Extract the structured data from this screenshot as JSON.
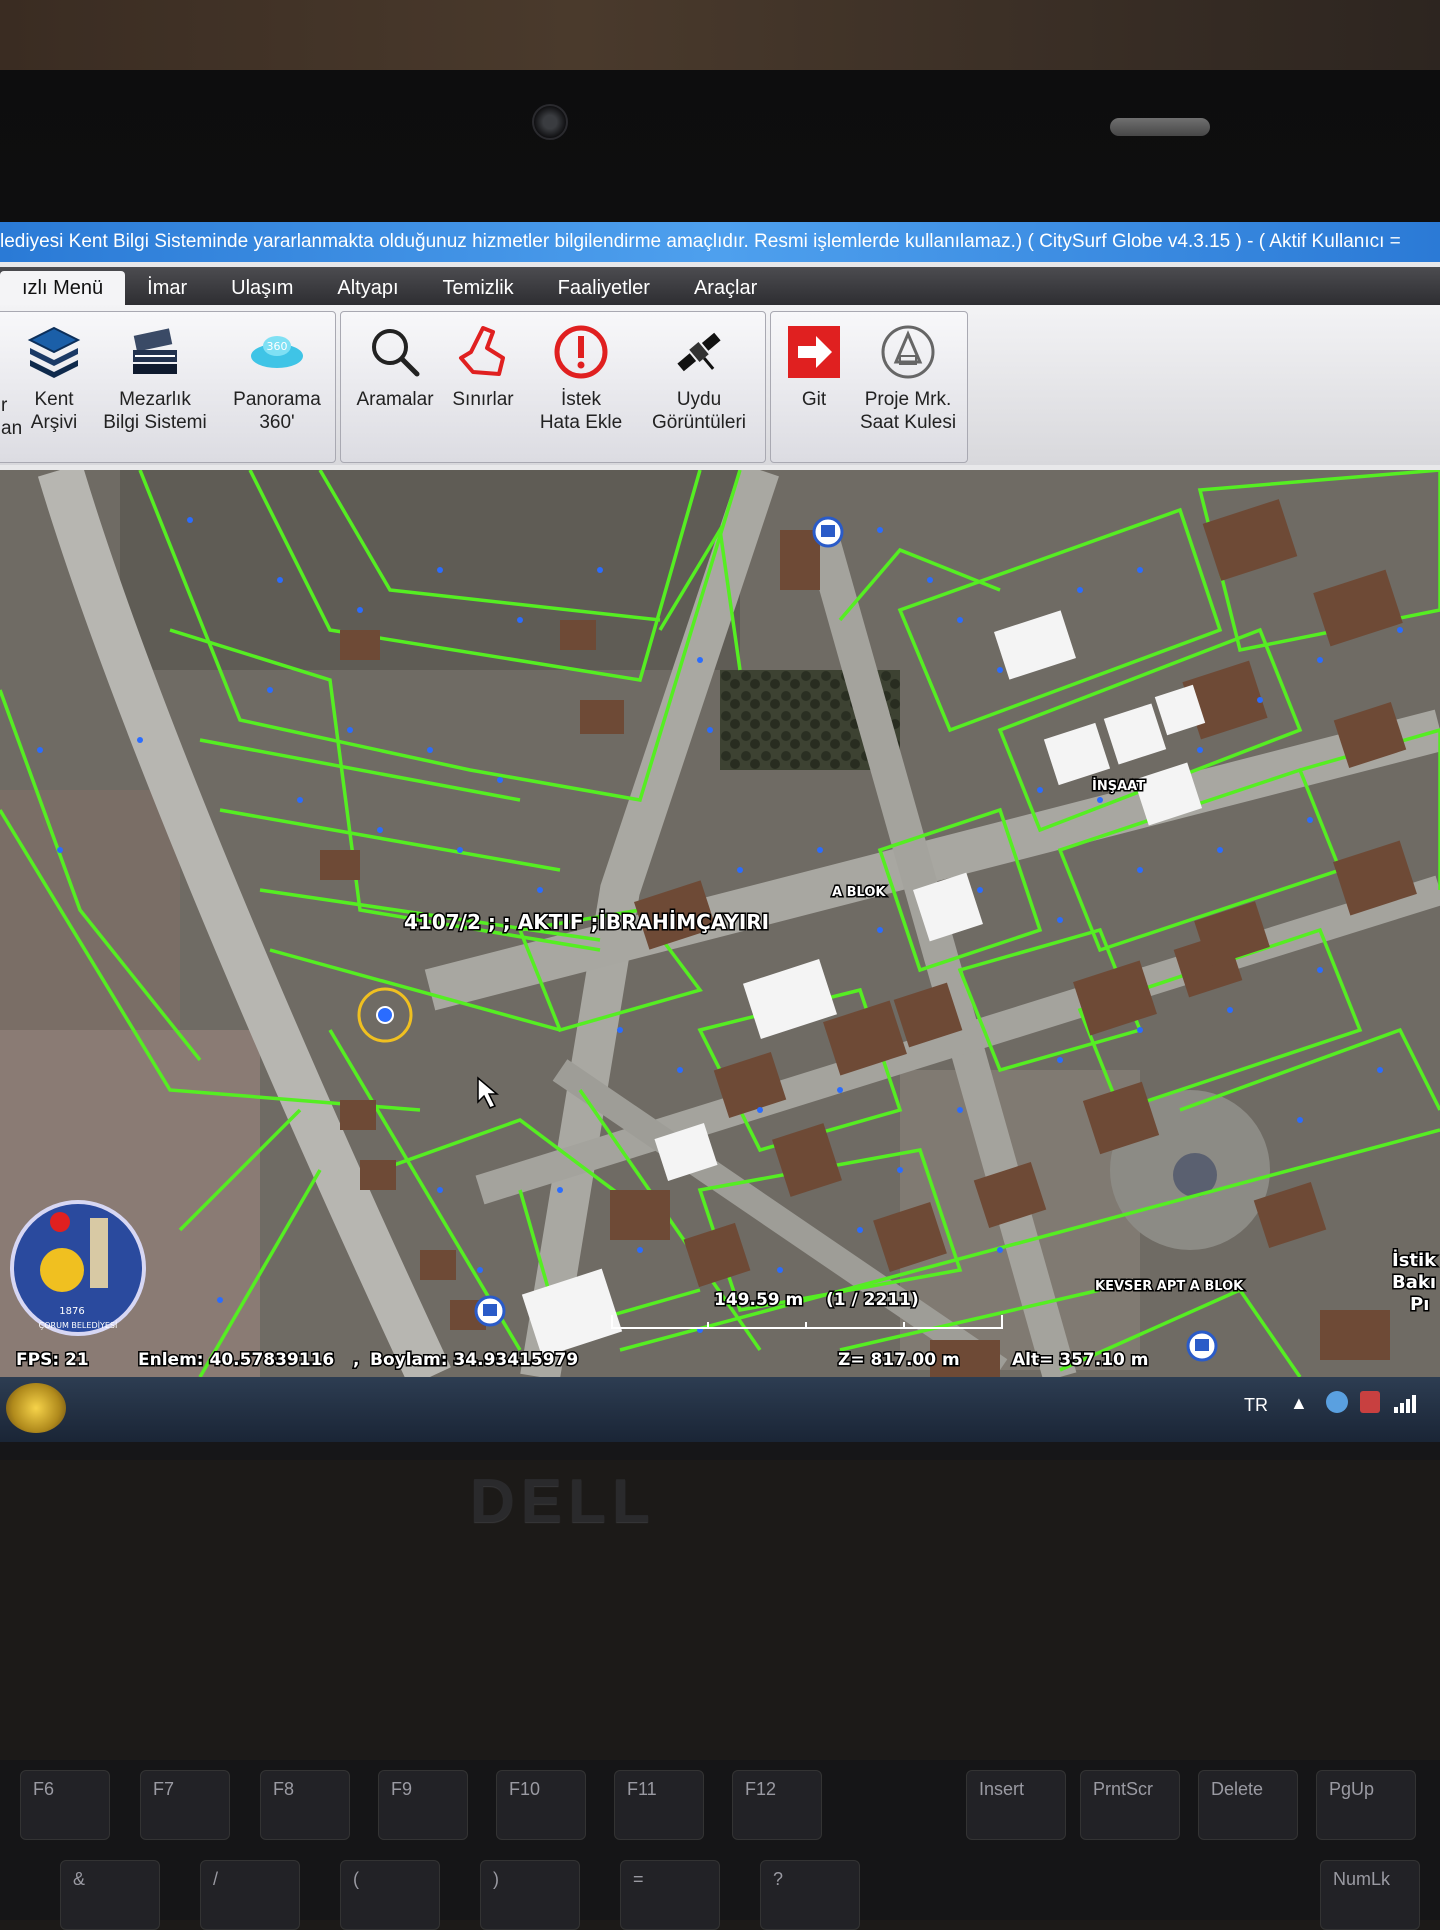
{
  "title_bar": "lediyesi Kent Bilgi Sisteminde yararlanmakta olduğunuz hizmetler bilgilendirme amaçlıdır. Resmi işlemlerde kullanılamaz.)  ( CitySurf Globe v4.3.15 )  -  ( Aktif Kullanıcı = ",
  "menu": [
    {
      "label": "ızlı Menü",
      "active": true
    },
    {
      "label": "İmar"
    },
    {
      "label": "Ulaşım"
    },
    {
      "label": "Altyapı"
    },
    {
      "label": "Temizlik"
    },
    {
      "label": "Faaliyetler"
    },
    {
      "label": "Araçlar"
    }
  ],
  "ribbon": {
    "group1": [
      {
        "label_1": "r",
        "label_2": "an",
        "icon": "partial-icon"
      },
      {
        "label_1": "Kent",
        "label_2": "Arşivi",
        "icon": "layers-icon"
      },
      {
        "label_1": "Mezarlık",
        "label_2": "Bilgi Sistemi",
        "icon": "book-stack-icon"
      },
      {
        "label_1": "Panorama",
        "label_2": "360'",
        "icon": "panorama-360-icon"
      }
    ],
    "group2": [
      {
        "label_1": "Aramalar",
        "label_2": "",
        "icon": "search-icon"
      },
      {
        "label_1": "Sınırlar",
        "label_2": "",
        "icon": "boundary-icon"
      },
      {
        "label_1": "İstek",
        "label_2": "Hata Ekle",
        "icon": "warning-icon"
      },
      {
        "label_1": "Uydu",
        "label_2": "Görüntüleri",
        "icon": "satellite-icon"
      }
    ],
    "group3": [
      {
        "label_1": "Git",
        "label_2": "",
        "icon": "go-arrow-icon"
      },
      {
        "label_1": "Proje Mrk.",
        "label_2": "Saat Kulesi",
        "icon": "clock-tower-icon"
      }
    ]
  },
  "map": {
    "parcel_label": "4107/2 ; ; AKTIF ;İBRAHİMÇAYIRI",
    "labels": [
      "A BLOK",
      "İNŞAAT",
      "KEVSER APT A BLOK",
      "İstik",
      "Bakı",
      "Pı"
    ],
    "scale_distance": "149.59 m",
    "scale_ratio": "(1 / 2211)",
    "fps": "FPS: 21",
    "lat": "Enlem: 40.57839116",
    "lon": "Boylam: 34.93415979",
    "z": "Z= 817.00 m",
    "alt": "Alt= 357.10 m",
    "logo_year": "1876",
    "logo_text": "ÇORUM BELEDİYESİ",
    "parcel_color": "#55ee22"
  },
  "taskbar": {
    "lang": "TR"
  },
  "brand": "DELL",
  "keys": [
    "F6",
    "F7",
    "F8",
    "F9",
    "F10",
    "F11",
    "F12",
    "Insert",
    "PrntScr",
    "Delete",
    "PgUp"
  ],
  "keys_row2": [
    "&",
    "/",
    "(",
    ")",
    "=",
    "?",
    "NumLk"
  ]
}
